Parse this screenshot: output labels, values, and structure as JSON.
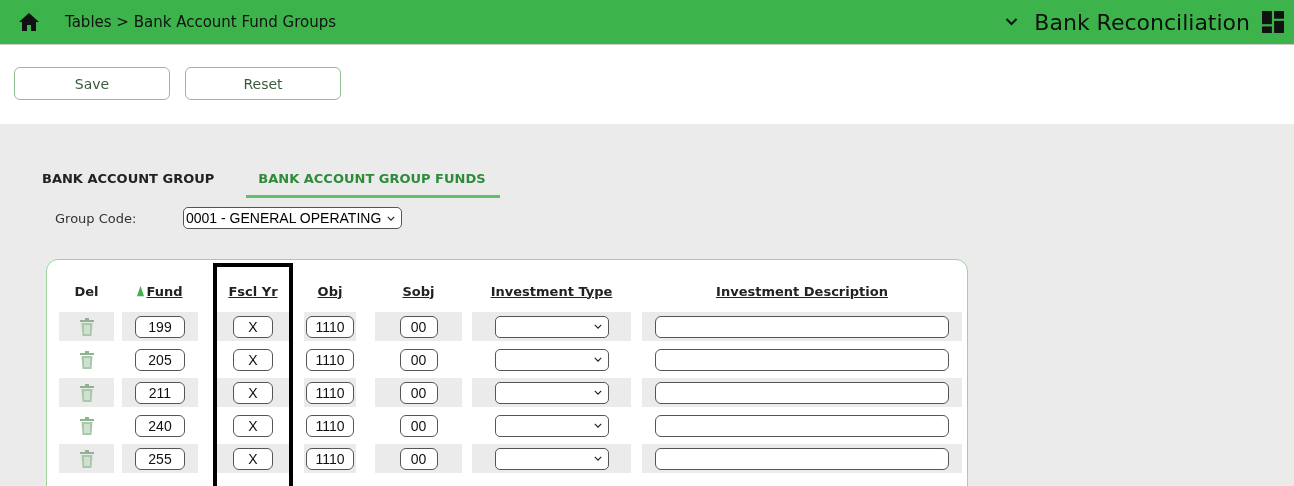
{
  "header": {
    "breadcrumb": "Tables > Bank Account Fund Groups",
    "app_title": "Bank Reconciliation"
  },
  "buttons": [
    "Save",
    "Reset"
  ],
  "tabs": [
    {
      "label": "BANK ACCOUNT GROUP",
      "selected": false
    },
    {
      "label": "BANK ACCOUNT GROUP FUNDS",
      "selected": true
    }
  ],
  "group_code": {
    "label": "Group Code:",
    "value": "0001 - GENERAL OPERATING"
  },
  "table": {
    "columns": [
      {
        "label": "Del",
        "sortable": false,
        "sorted": false,
        "highlighted": false
      },
      {
        "label": "Fund",
        "sortable": true,
        "sorted": true,
        "highlighted": false
      },
      {
        "label": "Fscl Yr",
        "sortable": true,
        "sorted": false,
        "highlighted": true
      },
      {
        "label": "Obj",
        "sortable": true,
        "sorted": false,
        "highlighted": false
      },
      {
        "label": "Sobj",
        "sortable": true,
        "sorted": false,
        "highlighted": false
      },
      {
        "label": "Investment Type",
        "sortable": true,
        "sorted": false,
        "highlighted": false
      },
      {
        "label": "Investment Description",
        "sortable": true,
        "sorted": false,
        "highlighted": false
      }
    ],
    "rows": [
      {
        "fund": "199",
        "fscl_yr": "X",
        "obj": "1110",
        "sobj": "00"
      },
      {
        "fund": "205",
        "fscl_yr": "X",
        "obj": "1110",
        "sobj": "00"
      },
      {
        "fund": "211",
        "fscl_yr": "X",
        "obj": "1110",
        "sobj": "00"
      },
      {
        "fund": "240",
        "fscl_yr": "X",
        "obj": "1110",
        "sobj": "00"
      },
      {
        "fund": "255",
        "fscl_yr": "X",
        "obj": "1110",
        "sobj": "00"
      }
    ]
  }
}
